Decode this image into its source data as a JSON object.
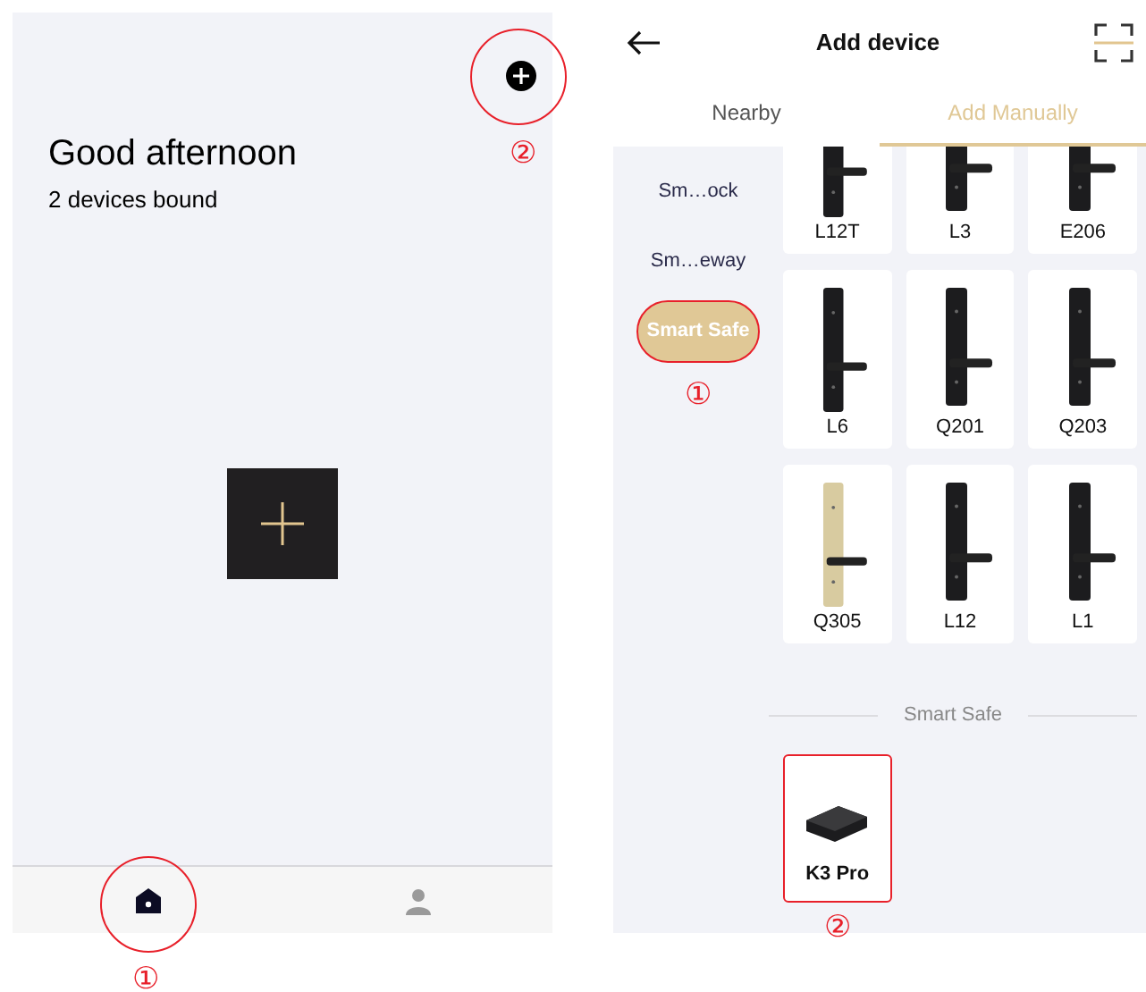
{
  "left_screen": {
    "greeting": "Good afternoon",
    "subtitle": "2 devices bound",
    "add_button": {
      "annotation": "②"
    },
    "tab_bar": [
      {
        "kind": "home",
        "selected": true,
        "annotation": "①"
      },
      {
        "kind": "profile",
        "selected": false
      }
    ]
  },
  "right_screen": {
    "title": "Add device",
    "tabs": [
      {
        "label": "Nearby",
        "selected": false
      },
      {
        "label": "Add Manually",
        "selected": true
      }
    ],
    "categories": [
      {
        "label": "Sm…ock",
        "selected": false
      },
      {
        "label": "Sm…eway",
        "selected": false
      },
      {
        "label": "Smart Safe",
        "selected": true,
        "annotation": "①"
      }
    ],
    "devices": [
      {
        "name": "L12T",
        "kind": "lock",
        "color": "#1c1c1e"
      },
      {
        "name": "L3",
        "kind": "lock",
        "color": "#1c1c1e"
      },
      {
        "name": "E206",
        "kind": "lock",
        "color": "#1c1c1e"
      },
      {
        "name": "L6",
        "kind": "lock",
        "color": "#1c1c1e"
      },
      {
        "name": "Q201",
        "kind": "lock",
        "color": "#1c1c1e"
      },
      {
        "name": "Q203",
        "kind": "lock",
        "color": "#1c1c1e"
      },
      {
        "name": "Q305",
        "kind": "lock",
        "color": "#d8cba0"
      },
      {
        "name": "L12",
        "kind": "lock",
        "color": "#1c1c1e"
      },
      {
        "name": "L1",
        "kind": "lock",
        "color": "#1c1c1e"
      }
    ],
    "section_title": "Smart Safe",
    "safe_devices": [
      {
        "name": "K3 Pro",
        "kind": "safe",
        "annotation": "②"
      }
    ]
  }
}
